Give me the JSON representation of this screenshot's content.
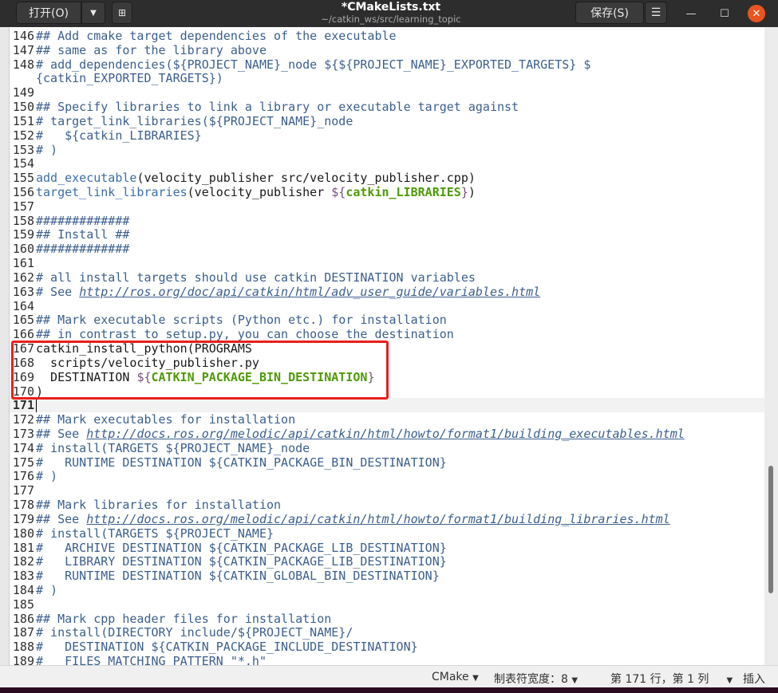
{
  "header": {
    "open_label": "打开(O)",
    "title": "*CMakeLists.txt",
    "path": "~/catkin_ws/src/learning_topic",
    "save_label": "保存(S)"
  },
  "status": {
    "language": "CMake",
    "tab_width": "制表符宽度：8",
    "position": "第 171 行，第 1 列",
    "mode": "插入"
  },
  "current_line": "171",
  "lines": [
    {
      "n": "146",
      "s": [
        [
          "cm",
          "## Add cmake target dependencies of the executable"
        ]
      ]
    },
    {
      "n": "147",
      "s": [
        [
          "cm",
          "## same as for the library above"
        ]
      ]
    },
    {
      "n": "148",
      "s": [
        [
          "cm",
          "# add_dependencies(${PROJECT_NAME}_node ${${PROJECT_NAME}_EXPORTED_TARGETS} $"
        ]
      ]
    },
    {
      "n": "",
      "s": [
        [
          "cm",
          "{catkin_EXPORTED_TARGETS})"
        ]
      ]
    },
    {
      "n": "149",
      "s": []
    },
    {
      "n": "150",
      "s": [
        [
          "cm",
          "## Specify libraries to link a library or executable target against"
        ]
      ]
    },
    {
      "n": "151",
      "s": [
        [
          "cm",
          "# target_link_libraries(${PROJECT_NAME}_node"
        ]
      ]
    },
    {
      "n": "152",
      "s": [
        [
          "cm",
          "#   ${catkin_LIBRARIES}"
        ]
      ]
    },
    {
      "n": "153",
      "s": [
        [
          "cm",
          "# )"
        ]
      ]
    },
    {
      "n": "154",
      "s": []
    },
    {
      "n": "155",
      "s": [
        [
          "fn",
          "add_executable"
        ],
        [
          "tx",
          "(velocity_publisher src/velocity_publisher.cpp)"
        ]
      ]
    },
    {
      "n": "156",
      "s": [
        [
          "fn",
          "target_link_libraries"
        ],
        [
          "tx",
          "(velocity_publisher "
        ],
        [
          "dl",
          "${"
        ],
        [
          "vr",
          "catkin_LIBRARIES"
        ],
        [
          "dl",
          "}"
        ],
        [
          "tx",
          ")"
        ]
      ]
    },
    {
      "n": "157",
      "s": []
    },
    {
      "n": "158",
      "s": [
        [
          "cm",
          "#############"
        ]
      ]
    },
    {
      "n": "159",
      "s": [
        [
          "cm",
          "## Install ##"
        ]
      ]
    },
    {
      "n": "160",
      "s": [
        [
          "cm",
          "#############"
        ]
      ]
    },
    {
      "n": "161",
      "s": []
    },
    {
      "n": "162",
      "s": [
        [
          "cm",
          "# all install targets should use catkin DESTINATION variables"
        ]
      ]
    },
    {
      "n": "163",
      "s": [
        [
          "cm",
          "# See "
        ],
        [
          "lk",
          "http://ros.org/doc/api/catkin/html/adv_user_guide/variables.html"
        ]
      ]
    },
    {
      "n": "164",
      "s": []
    },
    {
      "n": "165",
      "s": [
        [
          "cm",
          "## Mark executable scripts (Python etc.) for installation"
        ]
      ]
    },
    {
      "n": "166",
      "s": [
        [
          "cm",
          "## in contrast to setup.py, you can choose the destination"
        ]
      ]
    },
    {
      "n": "167",
      "s": [
        [
          "tx",
          "catkin_install_python(PROGRAMS"
        ]
      ]
    },
    {
      "n": "168",
      "s": [
        [
          "tx",
          "  scripts/velocity_publisher.py"
        ]
      ]
    },
    {
      "n": "169",
      "s": [
        [
          "tx",
          "  DESTINATION "
        ],
        [
          "dl",
          "${"
        ],
        [
          "vr",
          "CATKIN_PACKAGE_BIN_DESTINATION"
        ],
        [
          "dl",
          "}"
        ]
      ]
    },
    {
      "n": "170",
      "s": [
        [
          "tx",
          ")"
        ]
      ]
    },
    {
      "n": "171",
      "s": []
    },
    {
      "n": "172",
      "s": [
        [
          "cm",
          "## Mark executables for installation"
        ]
      ]
    },
    {
      "n": "173",
      "s": [
        [
          "cm",
          "## See "
        ],
        [
          "lk",
          "http://docs.ros.org/melodic/api/catkin/html/howto/format1/building_executables.html"
        ]
      ]
    },
    {
      "n": "174",
      "s": [
        [
          "cm",
          "# install(TARGETS ${PROJECT_NAME}_node"
        ]
      ]
    },
    {
      "n": "175",
      "s": [
        [
          "cm",
          "#   RUNTIME DESTINATION ${CATKIN_PACKAGE_BIN_DESTINATION}"
        ]
      ]
    },
    {
      "n": "176",
      "s": [
        [
          "cm",
          "# )"
        ]
      ]
    },
    {
      "n": "177",
      "s": []
    },
    {
      "n": "178",
      "s": [
        [
          "cm",
          "## Mark libraries for installation"
        ]
      ]
    },
    {
      "n": "179",
      "s": [
        [
          "cm",
          "## See "
        ],
        [
          "lk",
          "http://docs.ros.org/melodic/api/catkin/html/howto/format1/building_libraries.html"
        ]
      ]
    },
    {
      "n": "180",
      "s": [
        [
          "cm",
          "# install(TARGETS ${PROJECT_NAME}"
        ]
      ]
    },
    {
      "n": "181",
      "s": [
        [
          "cm",
          "#   ARCHIVE DESTINATION ${CATKIN_PACKAGE_LIB_DESTINATION}"
        ]
      ]
    },
    {
      "n": "182",
      "s": [
        [
          "cm",
          "#   LIBRARY DESTINATION ${CATKIN_PACKAGE_LIB_DESTINATION}"
        ]
      ]
    },
    {
      "n": "183",
      "s": [
        [
          "cm",
          "#   RUNTIME DESTINATION ${CATKIN_GLOBAL_BIN_DESTINATION}"
        ]
      ]
    },
    {
      "n": "184",
      "s": [
        [
          "cm",
          "# )"
        ]
      ]
    },
    {
      "n": "185",
      "s": []
    },
    {
      "n": "186",
      "s": [
        [
          "cm",
          "## Mark cpp header files for installation"
        ]
      ]
    },
    {
      "n": "187",
      "s": [
        [
          "cm",
          "# install(DIRECTORY include/${PROJECT_NAME}/"
        ]
      ]
    },
    {
      "n": "188",
      "s": [
        [
          "cm",
          "#   DESTINATION ${CATKIN_PACKAGE_INCLUDE_DESTINATION}"
        ]
      ]
    },
    {
      "n": "189",
      "s": [
        [
          "cm",
          "#   FILES_MATCHING_PATTERN \"*.h\""
        ]
      ]
    }
  ]
}
